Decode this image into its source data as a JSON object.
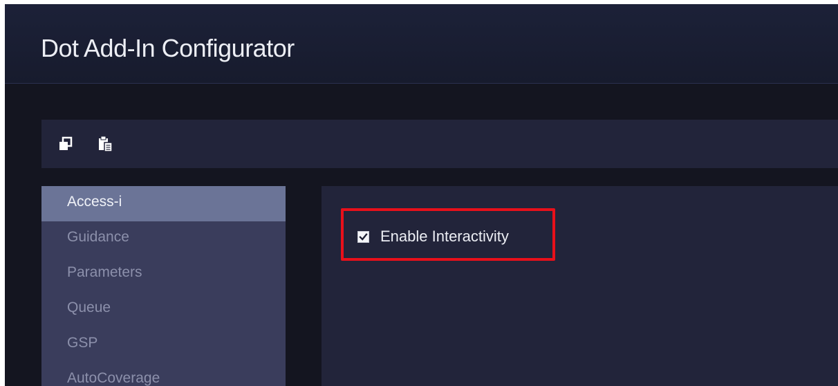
{
  "window": {
    "title": "Dot Add-In Configurator"
  },
  "toolbar": {
    "buttons": [
      {
        "icon": "copy-icon"
      },
      {
        "icon": "paste-icon"
      }
    ]
  },
  "sidebar": {
    "items": [
      {
        "label": "Access-i",
        "active": true
      },
      {
        "label": "Guidance",
        "active": false
      },
      {
        "label": "Parameters",
        "active": false
      },
      {
        "label": "Queue",
        "active": false
      },
      {
        "label": "GSP",
        "active": false
      },
      {
        "label": "AutoCoverage",
        "active": false
      }
    ]
  },
  "content": {
    "enable_interactivity": {
      "label": "Enable Interactivity",
      "checked": true
    }
  },
  "colors": {
    "highlight": "#e8101a",
    "active_nav": "#6b7497",
    "panel": "#22243a"
  }
}
